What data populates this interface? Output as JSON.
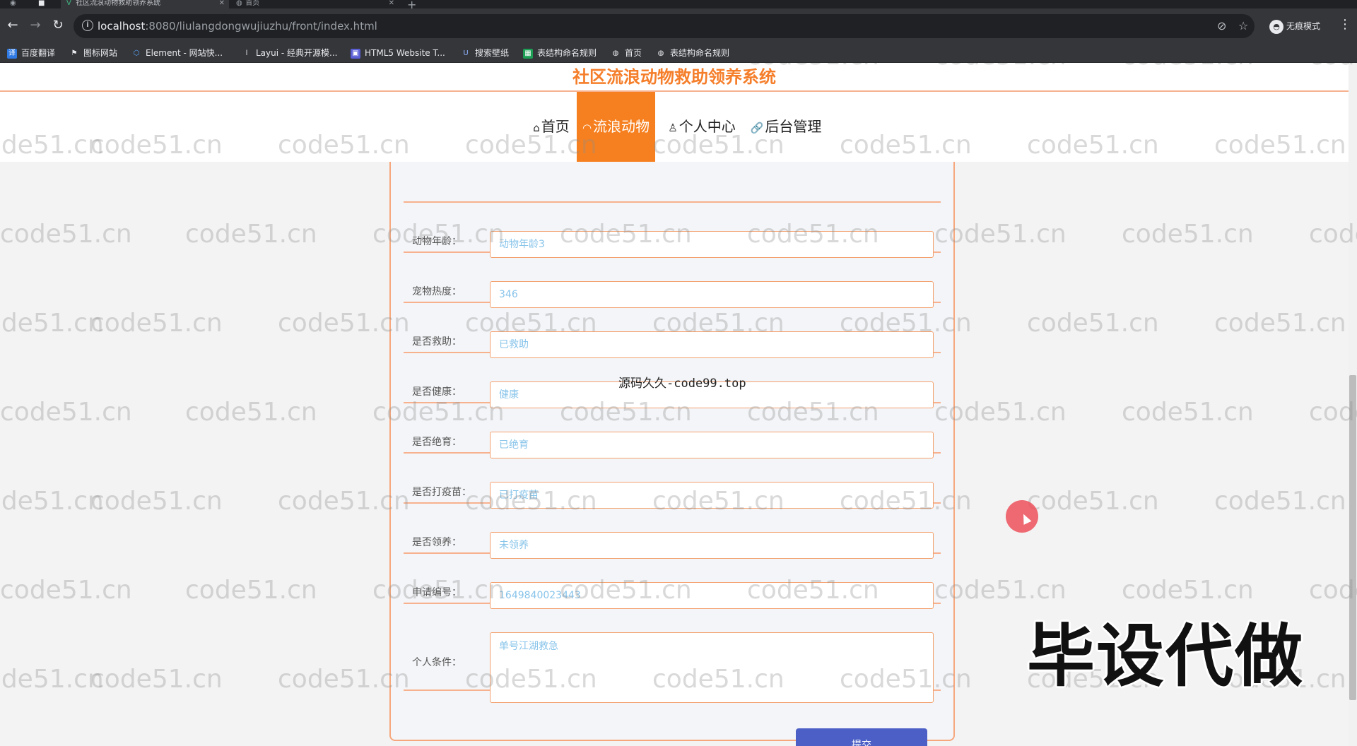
{
  "browser": {
    "tabs": [
      {
        "title": "社区流浪动物救助领养系统",
        "active": true
      },
      {
        "title": "首页",
        "active": false
      }
    ],
    "url": {
      "host": "localhost",
      "rest": ":8080/liulangdongwujiuzhu/front/index.html"
    },
    "incognito_label": "无痕模式",
    "bookmarks": [
      "百度翻译",
      "图标网站",
      "Element - 网站快...",
      "Layui - 经典开源模...",
      "HTML5 Website T...",
      "搜索壁纸",
      "表结构命名规则",
      "首页",
      "表结构命名规则"
    ]
  },
  "site": {
    "title": "社区流浪动物救助领养系统",
    "nav": [
      {
        "label": "首页",
        "icon": "⌂",
        "active": false
      },
      {
        "label": "流浪动物",
        "icon": "◠",
        "active": true
      },
      {
        "label": "个人中心",
        "icon": "♙",
        "active": false
      },
      {
        "label": "后台管理",
        "icon": "🔗",
        "active": false
      }
    ]
  },
  "form": {
    "fields": [
      {
        "label": "动物年龄：",
        "value": "动物年龄3"
      },
      {
        "label": "宠物热度：",
        "value": "346"
      },
      {
        "label": "是否救助：",
        "value": "已救助"
      },
      {
        "label": "是否健康：",
        "value": "健康"
      },
      {
        "label": "是否绝育：",
        "value": "已绝育"
      },
      {
        "label": "是否打疫苗：",
        "value": "已打疫苗"
      },
      {
        "label": "是否领养：",
        "value": "未领养"
      },
      {
        "label": "申请编号：",
        "value": "1649840023443"
      }
    ],
    "textarea": {
      "label": "个人条件：",
      "value": "单号江湖救急"
    },
    "submit_label": "提交"
  },
  "watermark_text": "code51.cn",
  "overlay_text": "源码久久-code99.top",
  "promo_text": "毕设代做"
}
